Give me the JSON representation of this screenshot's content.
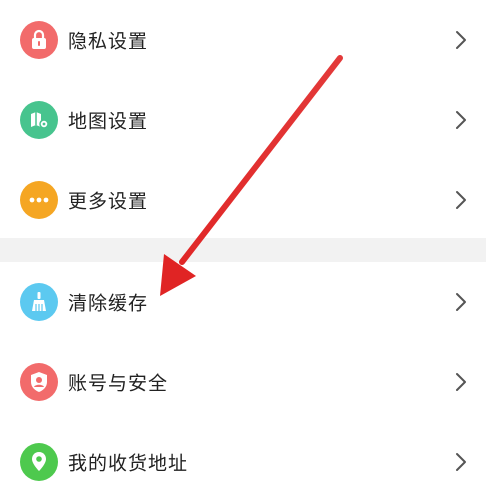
{
  "settings_group_1": [
    {
      "label": "隐私设置",
      "icon": "lock-icon",
      "color": "#f26b6b"
    },
    {
      "label": "地图设置",
      "icon": "map-settings-icon",
      "color": "#47c48e"
    },
    {
      "label": "更多设置",
      "icon": "more-dots-icon",
      "color": "#f5a623"
    }
  ],
  "settings_group_2": [
    {
      "label": "清除缓存",
      "icon": "broom-icon",
      "color": "#5cc9f0"
    },
    {
      "label": "账号与安全",
      "icon": "account-shield-icon",
      "color": "#f26b6b"
    },
    {
      "label": "我的收货地址",
      "icon": "location-pin-icon",
      "color": "#4ec94e"
    }
  ],
  "annotation": {
    "arrow_color": "#e02424"
  }
}
